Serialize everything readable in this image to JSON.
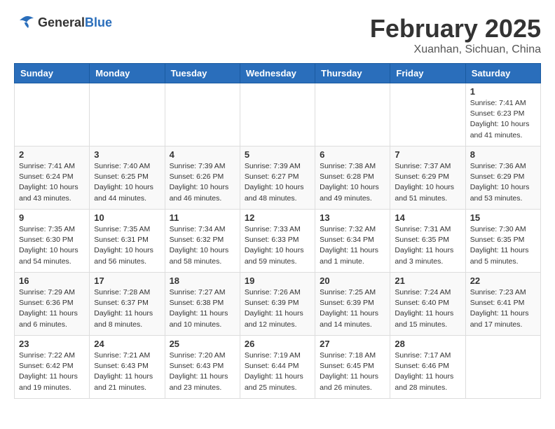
{
  "header": {
    "logo_general": "General",
    "logo_blue": "Blue",
    "month_year": "February 2025",
    "location": "Xuanhan, Sichuan, China"
  },
  "weekdays": [
    "Sunday",
    "Monday",
    "Tuesday",
    "Wednesday",
    "Thursday",
    "Friday",
    "Saturday"
  ],
  "weeks": [
    [
      {
        "day": "",
        "info": ""
      },
      {
        "day": "",
        "info": ""
      },
      {
        "day": "",
        "info": ""
      },
      {
        "day": "",
        "info": ""
      },
      {
        "day": "",
        "info": ""
      },
      {
        "day": "",
        "info": ""
      },
      {
        "day": "1",
        "info": "Sunrise: 7:41 AM\nSunset: 6:23 PM\nDaylight: 10 hours\nand 41 minutes."
      }
    ],
    [
      {
        "day": "2",
        "info": "Sunrise: 7:41 AM\nSunset: 6:24 PM\nDaylight: 10 hours\nand 43 minutes."
      },
      {
        "day": "3",
        "info": "Sunrise: 7:40 AM\nSunset: 6:25 PM\nDaylight: 10 hours\nand 44 minutes."
      },
      {
        "day": "4",
        "info": "Sunrise: 7:39 AM\nSunset: 6:26 PM\nDaylight: 10 hours\nand 46 minutes."
      },
      {
        "day": "5",
        "info": "Sunrise: 7:39 AM\nSunset: 6:27 PM\nDaylight: 10 hours\nand 48 minutes."
      },
      {
        "day": "6",
        "info": "Sunrise: 7:38 AM\nSunset: 6:28 PM\nDaylight: 10 hours\nand 49 minutes."
      },
      {
        "day": "7",
        "info": "Sunrise: 7:37 AM\nSunset: 6:29 PM\nDaylight: 10 hours\nand 51 minutes."
      },
      {
        "day": "8",
        "info": "Sunrise: 7:36 AM\nSunset: 6:29 PM\nDaylight: 10 hours\nand 53 minutes."
      }
    ],
    [
      {
        "day": "9",
        "info": "Sunrise: 7:35 AM\nSunset: 6:30 PM\nDaylight: 10 hours\nand 54 minutes."
      },
      {
        "day": "10",
        "info": "Sunrise: 7:35 AM\nSunset: 6:31 PM\nDaylight: 10 hours\nand 56 minutes."
      },
      {
        "day": "11",
        "info": "Sunrise: 7:34 AM\nSunset: 6:32 PM\nDaylight: 10 hours\nand 58 minutes."
      },
      {
        "day": "12",
        "info": "Sunrise: 7:33 AM\nSunset: 6:33 PM\nDaylight: 10 hours\nand 59 minutes."
      },
      {
        "day": "13",
        "info": "Sunrise: 7:32 AM\nSunset: 6:34 PM\nDaylight: 11 hours\nand 1 minute."
      },
      {
        "day": "14",
        "info": "Sunrise: 7:31 AM\nSunset: 6:35 PM\nDaylight: 11 hours\nand 3 minutes."
      },
      {
        "day": "15",
        "info": "Sunrise: 7:30 AM\nSunset: 6:35 PM\nDaylight: 11 hours\nand 5 minutes."
      }
    ],
    [
      {
        "day": "16",
        "info": "Sunrise: 7:29 AM\nSunset: 6:36 PM\nDaylight: 11 hours\nand 6 minutes."
      },
      {
        "day": "17",
        "info": "Sunrise: 7:28 AM\nSunset: 6:37 PM\nDaylight: 11 hours\nand 8 minutes."
      },
      {
        "day": "18",
        "info": "Sunrise: 7:27 AM\nSunset: 6:38 PM\nDaylight: 11 hours\nand 10 minutes."
      },
      {
        "day": "19",
        "info": "Sunrise: 7:26 AM\nSunset: 6:39 PM\nDaylight: 11 hours\nand 12 minutes."
      },
      {
        "day": "20",
        "info": "Sunrise: 7:25 AM\nSunset: 6:39 PM\nDaylight: 11 hours\nand 14 minutes."
      },
      {
        "day": "21",
        "info": "Sunrise: 7:24 AM\nSunset: 6:40 PM\nDaylight: 11 hours\nand 15 minutes."
      },
      {
        "day": "22",
        "info": "Sunrise: 7:23 AM\nSunset: 6:41 PM\nDaylight: 11 hours\nand 17 minutes."
      }
    ],
    [
      {
        "day": "23",
        "info": "Sunrise: 7:22 AM\nSunset: 6:42 PM\nDaylight: 11 hours\nand 19 minutes."
      },
      {
        "day": "24",
        "info": "Sunrise: 7:21 AM\nSunset: 6:43 PM\nDaylight: 11 hours\nand 21 minutes."
      },
      {
        "day": "25",
        "info": "Sunrise: 7:20 AM\nSunset: 6:43 PM\nDaylight: 11 hours\nand 23 minutes."
      },
      {
        "day": "26",
        "info": "Sunrise: 7:19 AM\nSunset: 6:44 PM\nDaylight: 11 hours\nand 25 minutes."
      },
      {
        "day": "27",
        "info": "Sunrise: 7:18 AM\nSunset: 6:45 PM\nDaylight: 11 hours\nand 26 minutes."
      },
      {
        "day": "28",
        "info": "Sunrise: 7:17 AM\nSunset: 6:46 PM\nDaylight: 11 hours\nand 28 minutes."
      },
      {
        "day": "",
        "info": ""
      }
    ]
  ]
}
